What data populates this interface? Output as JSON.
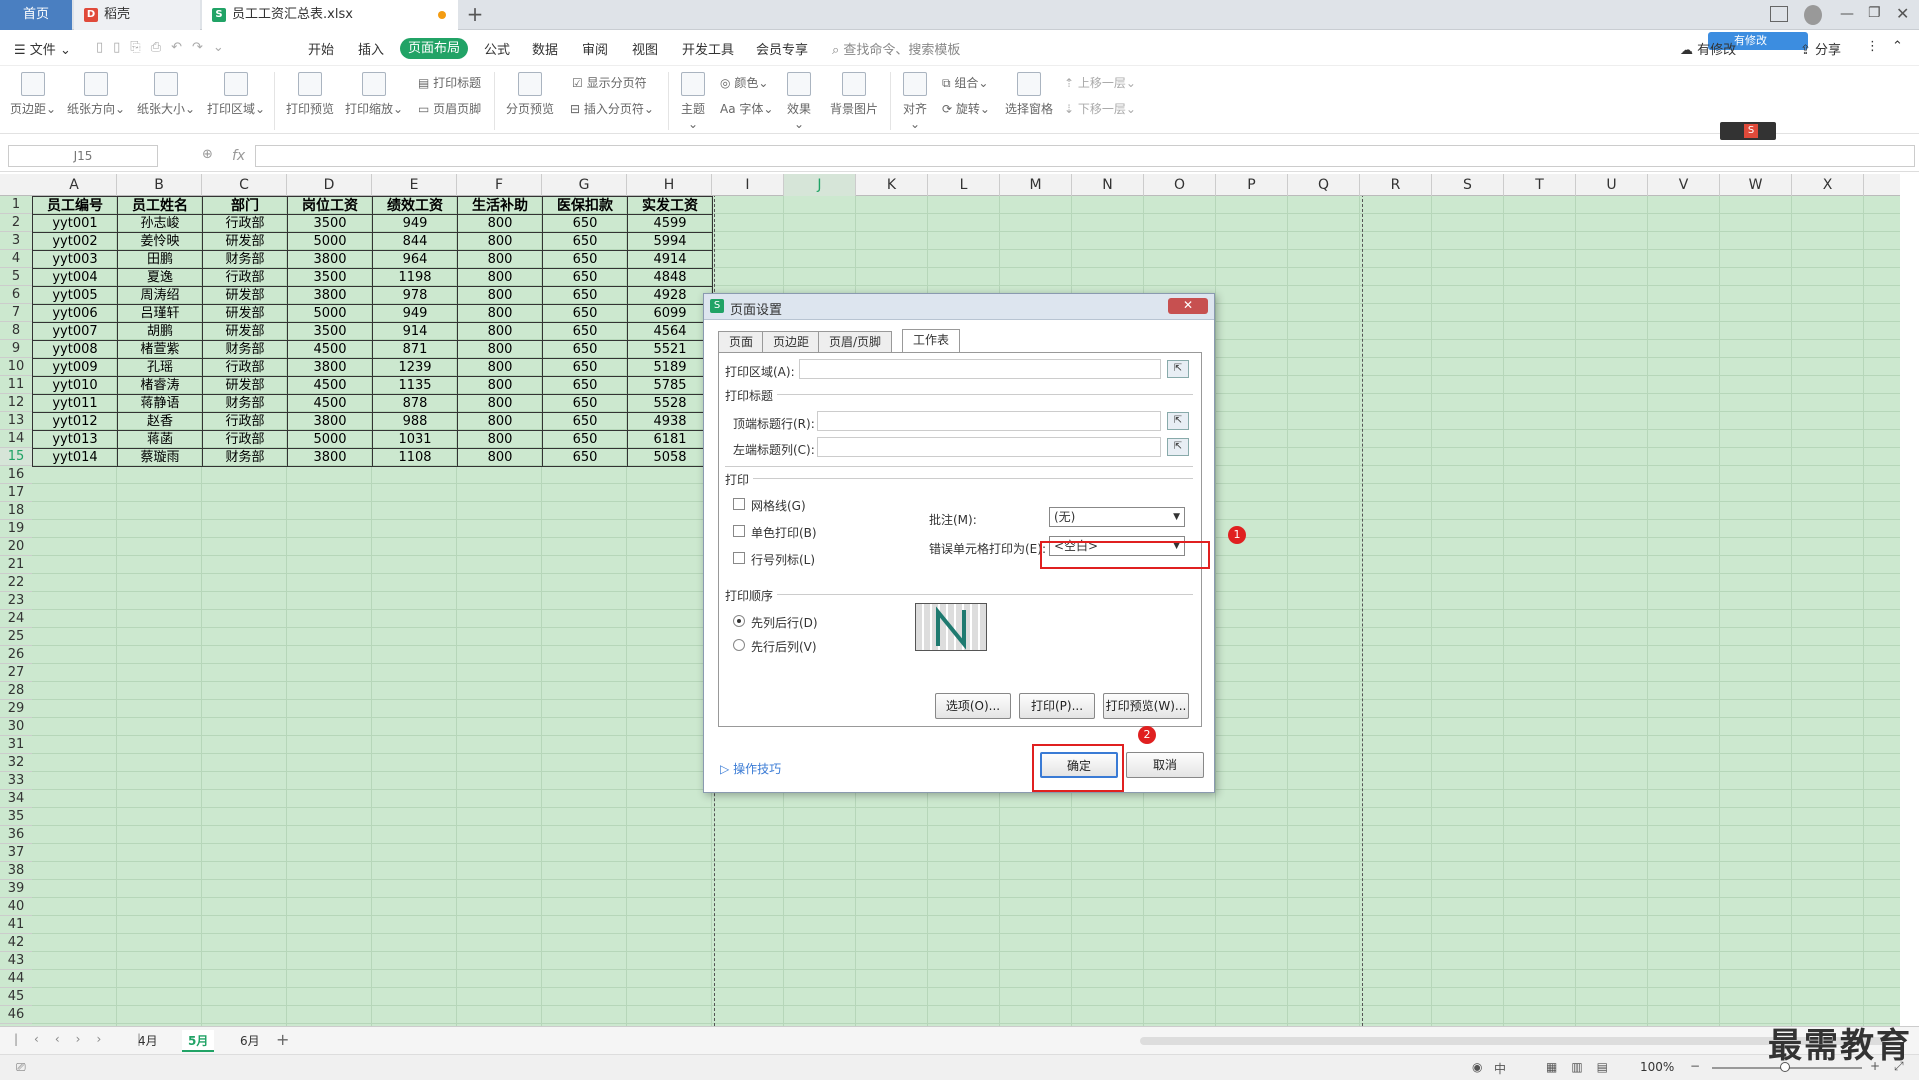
{
  "titlebar": {
    "tab_home": "首页",
    "tab_daoke": "稻壳",
    "tab_file": "员工工资汇总表.xlsx",
    "add_tab": "+"
  },
  "menubar": {
    "file": "文件",
    "items": [
      "开始",
      "插入",
      "页面布局",
      "公式",
      "数据",
      "审阅",
      "视图",
      "开发工具",
      "会员专享"
    ],
    "search": "查找命令、搜索模板",
    "share": "分享",
    "sync": "有修改",
    "cloud_badge": "有修改"
  },
  "ribbon": {
    "margins": "页边距",
    "orientation": "纸张方向",
    "size": "纸张大小",
    "print_area": "打印区域",
    "print_preview": "打印预览",
    "print_scale": "打印缩放",
    "print_titles": "打印标题",
    "header_footer": "页眉页脚",
    "page_break_preview": "分页预览",
    "show_breaks": "显示分页符",
    "insert_break": "插入分页符",
    "theme": "主题",
    "colors": "颜色",
    "fonts": "字体",
    "effects": "效果",
    "background": "背景图片",
    "align": "对齐",
    "group": "组合",
    "rotate": "旋转",
    "selection_pane": "选择窗格",
    "bring_forward": "上移一层",
    "send_backward": "下移一层"
  },
  "formula_bar": {
    "cell_ref": "J15",
    "fx": "fx",
    "value": ""
  },
  "columns": [
    "A",
    "B",
    "C",
    "D",
    "E",
    "F",
    "G",
    "H",
    "I",
    "J",
    "K",
    "L",
    "M",
    "N",
    "O",
    "P",
    "Q",
    "R",
    "S",
    "T",
    "U",
    "V",
    "W",
    "X"
  ],
  "rows": [
    "1",
    "2",
    "3",
    "4",
    "5",
    "6",
    "7",
    "8",
    "9",
    "10",
    "11",
    "12",
    "13",
    "14",
    "15",
    "16",
    "17",
    "18",
    "19",
    "20",
    "21",
    "22",
    "23",
    "24",
    "25",
    "26",
    "27",
    "28",
    "29",
    "30",
    "31",
    "32",
    "33",
    "34",
    "35",
    "36",
    "37",
    "38",
    "39",
    "40",
    "41",
    "42",
    "43",
    "44",
    "45",
    "46"
  ],
  "table": {
    "headers": [
      "员工编号",
      "员工姓名",
      "部门",
      "岗位工资",
      "绩效工资",
      "生活补助",
      "医保扣款",
      "实发工资"
    ],
    "rows": [
      [
        "yyt001",
        "孙志峻",
        "行政部",
        "3500",
        "949",
        "800",
        "650",
        "4599"
      ],
      [
        "yyt002",
        "姜怜映",
        "研发部",
        "5000",
        "844",
        "800",
        "650",
        "5994"
      ],
      [
        "yyt003",
        "田鹏",
        "财务部",
        "3800",
        "964",
        "800",
        "650",
        "4914"
      ],
      [
        "yyt004",
        "夏逸",
        "行政部",
        "3500",
        "1198",
        "800",
        "650",
        "4848"
      ],
      [
        "yyt005",
        "周涛绍",
        "研发部",
        "3800",
        "978",
        "800",
        "650",
        "4928"
      ],
      [
        "yyt006",
        "吕瑾轩",
        "研发部",
        "5000",
        "949",
        "800",
        "650",
        "6099"
      ],
      [
        "yyt007",
        "胡鹏",
        "研发部",
        "3500",
        "914",
        "800",
        "650",
        "4564"
      ],
      [
        "yyt008",
        "楮萱紫",
        "财务部",
        "4500",
        "871",
        "800",
        "650",
        "5521"
      ],
      [
        "yyt009",
        "孔瑶",
        "行政部",
        "3800",
        "1239",
        "800",
        "650",
        "5189"
      ],
      [
        "yyt010",
        "楮睿涛",
        "研发部",
        "4500",
        "1135",
        "800",
        "650",
        "5785"
      ],
      [
        "yyt011",
        "蒋静语",
        "财务部",
        "4500",
        "878",
        "800",
        "650",
        "5528"
      ],
      [
        "yyt012",
        "赵香",
        "行政部",
        "3800",
        "988",
        "800",
        "650",
        "4938"
      ],
      [
        "yyt013",
        "蒋菡",
        "行政部",
        "5000",
        "1031",
        "800",
        "650",
        "6181"
      ],
      [
        "yyt014",
        "蔡璇雨",
        "财务部",
        "3800",
        "1108",
        "800",
        "650",
        "5058"
      ]
    ]
  },
  "sheets": [
    "4月",
    "5月",
    "6月"
  ],
  "active_sheet": "5月",
  "status": {
    "zoom": "100%",
    "lang": "中"
  },
  "dialog": {
    "title": "页面设置",
    "close": "✕",
    "tabs": [
      "页面",
      "页边距",
      "页眉/页脚",
      "工作表"
    ],
    "active_tab": "工作表",
    "print_area_label": "打印区域(A):",
    "print_titles_section": "打印标题",
    "top_rows_label": "顶端标题行(R):",
    "left_cols_label": "左端标题列(C):",
    "print_section": "打印",
    "gridlines": "网格线(G)",
    "bw_print": "单色打印(B)",
    "row_col_headers": "行号列标(L)",
    "comments_label": "批注(M):",
    "comments_value": "(无)",
    "errors_label": "错误单元格打印为(E):",
    "errors_value": "<空白>",
    "order_section": "打印顺序",
    "down_then_over": "先列后行(D)",
    "over_then_down": "先行后列(V)",
    "options_btn": "选项(O)...",
    "print_btn": "打印(P)...",
    "preview_btn": "打印预览(W)...",
    "tips": "操作技巧",
    "ok": "确定",
    "cancel": "取消",
    "marker1": "1",
    "marker2": "2"
  },
  "watermark": "最需教育",
  "colors": {
    "accent": "#21a366",
    "grid_bg": "#cce8cf",
    "highlight": "#e02020"
  }
}
